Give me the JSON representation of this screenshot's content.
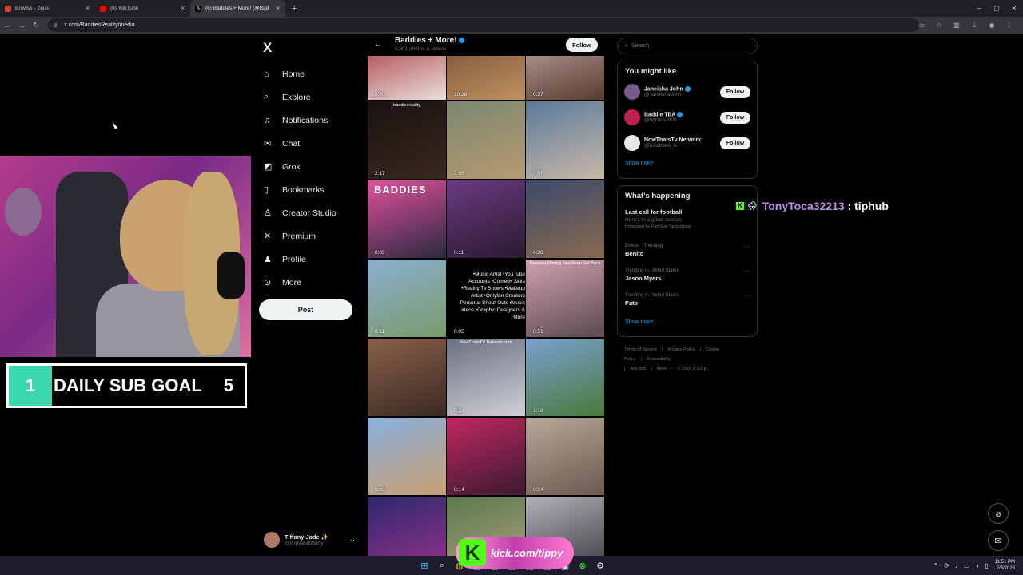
{
  "browser": {
    "tabs": [
      {
        "title": "Browse - Zeus",
        "color": "#e53935",
        "active": false
      },
      {
        "title": "(8) YouTube",
        "color": "#ff0000",
        "active": false
      },
      {
        "title": "(6) Baddies + More! (@Bad",
        "color": "#000000",
        "active": true
      }
    ],
    "new_tab": "+",
    "url": "x.com/BaddiesReality/media"
  },
  "overlay": {
    "goal": {
      "current": "1",
      "label": "DAILY SUB GOAL",
      "target": "5"
    },
    "chat": {
      "user": "TonyToca32213",
      "separator": " : ",
      "message": "tiphub"
    },
    "kick_url": "kick.com/tippy",
    "kick_letter": "K"
  },
  "sidebar": {
    "logo": "X",
    "items": [
      {
        "label": "Home",
        "icon": "home-icon",
        "glyph": "⌂"
      },
      {
        "label": "Explore",
        "icon": "search-icon",
        "glyph": "⌕"
      },
      {
        "label": "Notifications",
        "icon": "bell-icon",
        "glyph": "♫"
      },
      {
        "label": "Chat",
        "icon": "mail-icon",
        "glyph": "✉"
      },
      {
        "label": "Grok",
        "icon": "grok-icon",
        "glyph": "◩"
      },
      {
        "label": "Bookmarks",
        "icon": "bookmark-icon",
        "glyph": "▯"
      },
      {
        "label": "Creator Studio",
        "icon": "creator-icon",
        "glyph": "♙"
      },
      {
        "label": "Premium",
        "icon": "x-icon",
        "glyph": "✕"
      },
      {
        "label": "Profile",
        "icon": "profile-icon",
        "glyph": "♟"
      },
      {
        "label": "More",
        "icon": "more-icon",
        "glyph": "⊙"
      }
    ],
    "post_label": "Post",
    "account": {
      "name": "Tiffany Jade ✨",
      "handle": "@tippyandtiffany",
      "more": "···"
    }
  },
  "profile": {
    "name": "Baddies + More!",
    "subtitle": "5,801 photos & videos",
    "follow_label": "Follow"
  },
  "media": [
    {
      "dur": "0:40",
      "c1": "#a3202a",
      "c2": "#e8e0dc"
    },
    {
      "dur": "10:28",
      "c1": "#6a4a30",
      "c2": "#c09060"
    },
    {
      "dur": "",
      "c1": "#000000",
      "c2": "#000000"
    },
    {
      "dur": "0:37",
      "c1": "#c8b4b0",
      "c2": "#5a3a30"
    },
    {
      "dur": "2:17",
      "c1": "#1a1210",
      "c2": "#3a2820",
      "caption": "baddiesreality"
    },
    {
      "dur": "1:05",
      "c1": "#7a8870",
      "c2": "#b89a70"
    },
    {
      "dur": "0:07",
      "c1": "#5a7a9a",
      "c2": "#c8b8a8"
    },
    {
      "dur": "0:03",
      "c1": "#e0509a",
      "c2": "#2a2a40",
      "title": "BADDIES"
    },
    {
      "dur": "0:11",
      "c1": "#6a3a80",
      "c2": "#2a1a30"
    },
    {
      "dur": "0:28",
      "c1": "#3a4a6a",
      "c2": "#8a6a50"
    },
    {
      "dur": "0:11",
      "c1": "#8ab0d0",
      "c2": "#7a9a6a"
    },
    {
      "dur": "0:05",
      "c1": "#000000",
      "c2": "#000000",
      "lines": [
        "•Music Artist •YouTube",
        "Accounts •Comedy Skits",
        "•Reality Tv Shows •Makeup",
        "Artist •Onlyfan Creators",
        "Personal Shout-Outs •Music",
        "ideos •Graphic Designers &",
        "More"
      ]
    },
    {
      "dur": "0:51",
      "c1": "#d0a0b0",
      "c2": "#5a4a50",
      "caption": "Reunion Filming Has Been Set Back"
    },
    {
      "dur": "",
      "c1": "#8a6048",
      "c2": "#3a2a24"
    },
    {
      "dur": "0:51",
      "c1": "#6a7080",
      "c2": "#d0d0d8",
      "caption": "NowThatsTV Network.com"
    },
    {
      "dur": "1:18",
      "c1": "#7aa0d0",
      "c2": "#4a7a3a"
    },
    {
      "dur": "0:33",
      "c1": "#8ab0e0",
      "c2": "#c8a070"
    },
    {
      "dur": "0:14",
      "c1": "#c02860",
      "c2": "#3a1a30"
    },
    {
      "dur": "0:24",
      "c1": "#b8a898",
      "c2": "#6a5a50"
    },
    {
      "dur": "",
      "c1": "#2a2a6a",
      "c2": "#9a3090"
    },
    {
      "dur": "",
      "c1": "#5a7a4a",
      "c2": "#b0a080"
    },
    {
      "dur": "",
      "c1": "#b0b0b8",
      "c2": "#3a3a40"
    }
  ],
  "right": {
    "search_placeholder": "Search",
    "you_might_like": {
      "title": "You might like",
      "accounts": [
        {
          "name": "Janeisha John",
          "handle": "@JaneishaJohn",
          "verified": true,
          "color": "#7a5a8a",
          "follow": "Follow"
        },
        {
          "name": "Baddie TEA",
          "handle": "@bgctea2020",
          "verified": true,
          "color": "#c02050",
          "follow": "Follow"
        },
        {
          "name": "NowThatsTv Network",
          "handle": "@nowthats_tv",
          "verified": false,
          "color": "#e8e8e8",
          "follow": "Follow"
        }
      ],
      "show_more": "Show more"
    },
    "whats_happening": {
      "title": "What's happening",
      "trends": [
        {
          "context": "",
          "title": "Last call for football",
          "desc": "Here's to a great season",
          "promo": "Promoted by FanDuel Sportsbook"
        },
        {
          "context": "Events · Trending",
          "title": "Benito",
          "desc": "",
          "promo": ""
        },
        {
          "context": "Trending in United States",
          "title": "Jason Myers",
          "desc": "",
          "promo": ""
        },
        {
          "context": "Trending in United States",
          "title": "Pats",
          "desc": "",
          "promo": ""
        }
      ],
      "show_more": "Show more"
    },
    "footer": [
      "Terms of Service",
      "|",
      "Privacy Policy",
      "|",
      "Cookie Policy",
      "|",
      "Accessibility",
      "|",
      "Ads info",
      "|",
      "More ···",
      "© 2026 X Corp."
    ]
  },
  "taskbar": {
    "time": "11:51 PM",
    "date": "2/8/2026"
  }
}
